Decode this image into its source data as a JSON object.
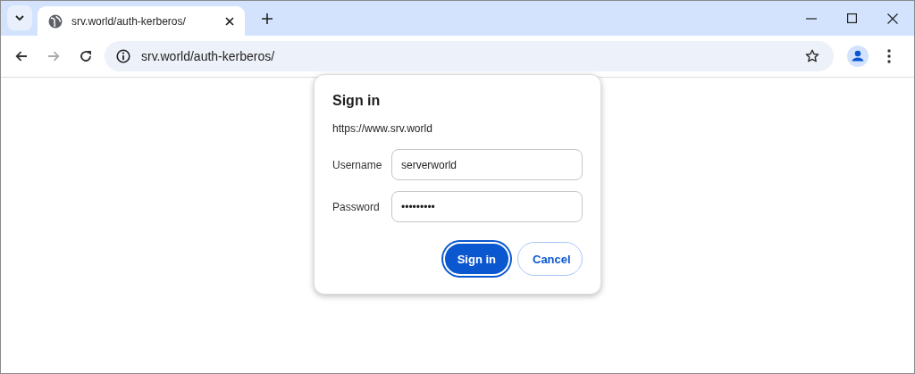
{
  "tab": {
    "title": "srv.world/auth-kerberos/",
    "selected": true
  },
  "address_bar": {
    "url": "srv.world/auth-kerberos/"
  },
  "navigation": {
    "forward_disabled": true
  },
  "dialog": {
    "title": "Sign in",
    "origin": "https://www.srv.world",
    "fields": [
      {
        "label": "Username",
        "value": "serverworld"
      },
      {
        "label": "Password",
        "value": "•••••••••"
      }
    ],
    "buttons": [
      {
        "label": "Sign in",
        "kind": "primary"
      },
      {
        "label": "Cancel",
        "kind": "secondary"
      }
    ]
  }
}
